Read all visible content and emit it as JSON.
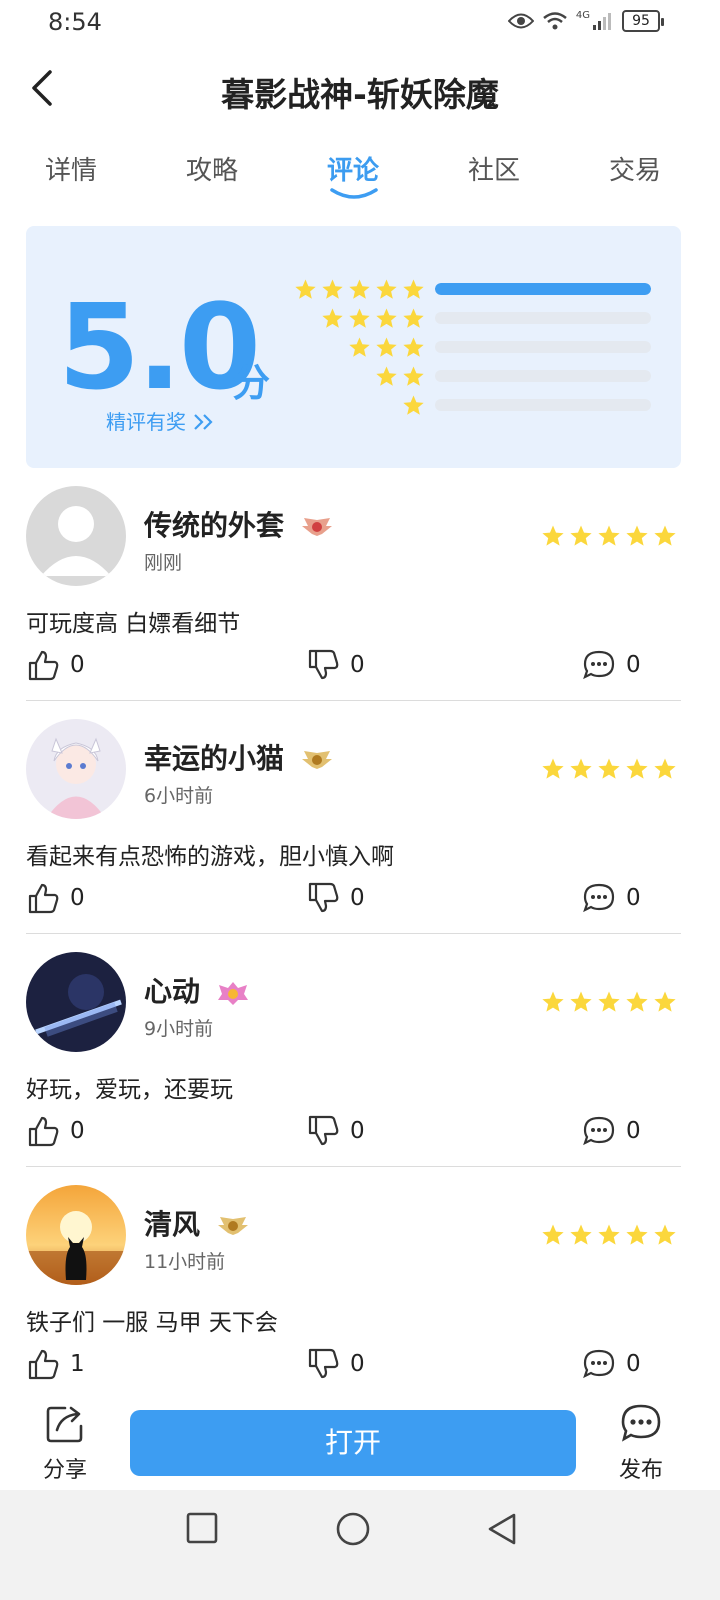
{
  "status_bar": {
    "time": "8:54",
    "battery": "95",
    "network": "4G"
  },
  "header": {
    "title": "暮影战神-斩妖除魔"
  },
  "tabs": [
    {
      "label": "详情"
    },
    {
      "label": "攻略"
    },
    {
      "label": "评论"
    },
    {
      "label": "社区"
    },
    {
      "label": "交易"
    }
  ],
  "active_tab": "评论",
  "rating": {
    "score": "5.0",
    "unit": "分",
    "reward_link": "精评有奖",
    "distribution": [
      {
        "stars": 5,
        "fraction": 1.0
      },
      {
        "stars": 4,
        "fraction": 0.0
      },
      {
        "stars": 3,
        "fraction": 0.0
      },
      {
        "stars": 2,
        "fraction": 0.0
      },
      {
        "stars": 1,
        "fraction": 0.0
      }
    ]
  },
  "reviews": [
    {
      "username": "传统的外套",
      "time": "刚刚",
      "stars": 5,
      "text": "可玩度高 白嫖看细节",
      "likes": "0",
      "dislikes": "0",
      "comments": "0"
    },
    {
      "username": "幸运的小猫",
      "time": "6小时前",
      "stars": 5,
      "text": "看起来有点恐怖的游戏，胆小慎入啊",
      "likes": "0",
      "dislikes": "0",
      "comments": "0"
    },
    {
      "username": "心动",
      "time": "9小时前",
      "stars": 5,
      "text": "好玩，爱玩，还要玩",
      "likes": "0",
      "dislikes": "0",
      "comments": "0"
    },
    {
      "username": "清风",
      "time": "11小时前",
      "stars": 5,
      "text": "铁子们 一服 马甲 天下会",
      "likes": "1",
      "dislikes": "0",
      "comments": "0"
    }
  ],
  "bottom_bar": {
    "share_label": "分享",
    "open_label": "打开",
    "publish_label": "发布"
  },
  "colors": {
    "accent": "#3d9df2",
    "star": "#fbd73c",
    "card_bg": "#e8f1fd"
  }
}
